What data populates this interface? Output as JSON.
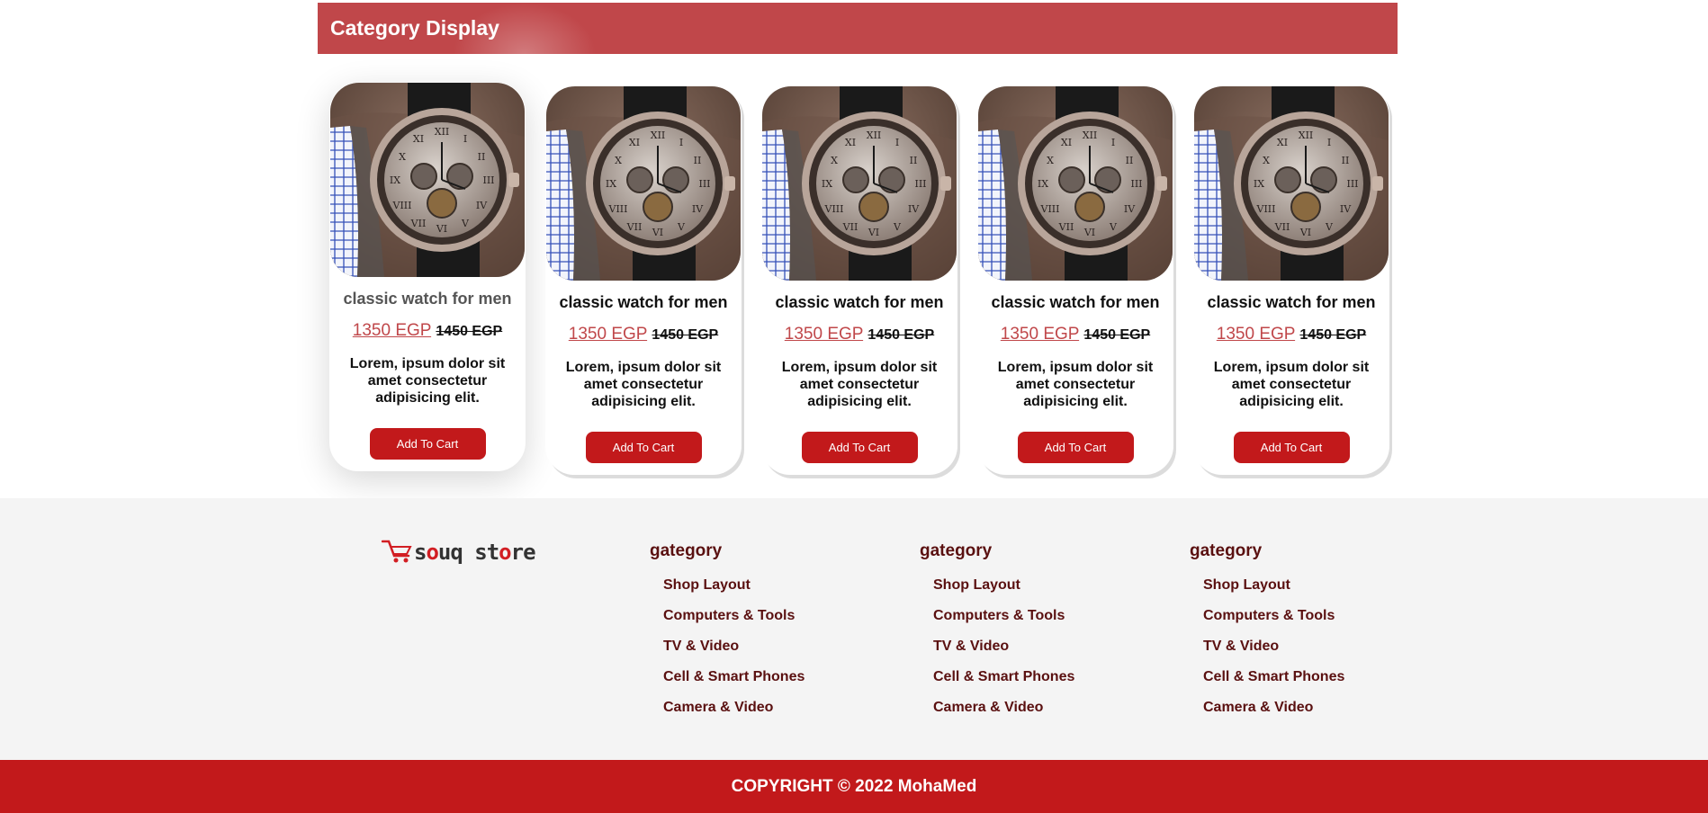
{
  "header": {
    "title": "Category Display"
  },
  "products": [
    {
      "name": "classic watch for men",
      "price": "1350 EGP",
      "old_price": "1450 EGP",
      "description": "Lorem, ipsum dolor sit amet consectetur adipisicing elit.",
      "button": "Add To Cart"
    },
    {
      "name": "classic watch for men",
      "price": "1350 EGP",
      "old_price": "1450 EGP",
      "description": "Lorem, ipsum dolor sit amet consectetur adipisicing elit.",
      "button": "Add To Cart"
    },
    {
      "name": "classic watch for men",
      "price": "1350 EGP",
      "old_price": "1450 EGP",
      "description": "Lorem, ipsum dolor sit amet consectetur adipisicing elit.",
      "button": "Add To Cart"
    },
    {
      "name": "classic watch for men",
      "price": "1350 EGP",
      "old_price": "1450 EGP",
      "description": "Lorem, ipsum dolor sit amet consectetur adipisicing elit.",
      "button": "Add To Cart"
    },
    {
      "name": "classic watch for men",
      "price": "1350 EGP",
      "old_price": "1450 EGP",
      "description": "Lorem, ipsum dolor sit amet consectetur adipisicing elit.",
      "button": "Add To Cart"
    }
  ],
  "footer": {
    "logo": "souq store",
    "columns": [
      {
        "heading": "gategory",
        "links": [
          "Shop Layout",
          "Computers & Tools",
          "TV & Video",
          "Cell & Smart Phones",
          "Camera & Video"
        ]
      },
      {
        "heading": "gategory",
        "links": [
          "Shop Layout",
          "Computers & Tools",
          "TV & Video",
          "Cell & Smart Phones",
          "Camera & Video"
        ]
      },
      {
        "heading": "gategory",
        "links": [
          "Shop Layout",
          "Computers & Tools",
          "TV & Video",
          "Cell & Smart Phones",
          "Camera & Video"
        ]
      }
    ],
    "copyright": "COPYRIGHT © 2022 MohaMed"
  },
  "colors": {
    "brand_red": "#c2191b",
    "header_red": "#c0474a",
    "footer_bg": "#f4f4f4",
    "footer_link": "#5a1010"
  },
  "icons": {
    "logo": "shopping-cart-icon",
    "product_image": "wristwatch-photo"
  }
}
